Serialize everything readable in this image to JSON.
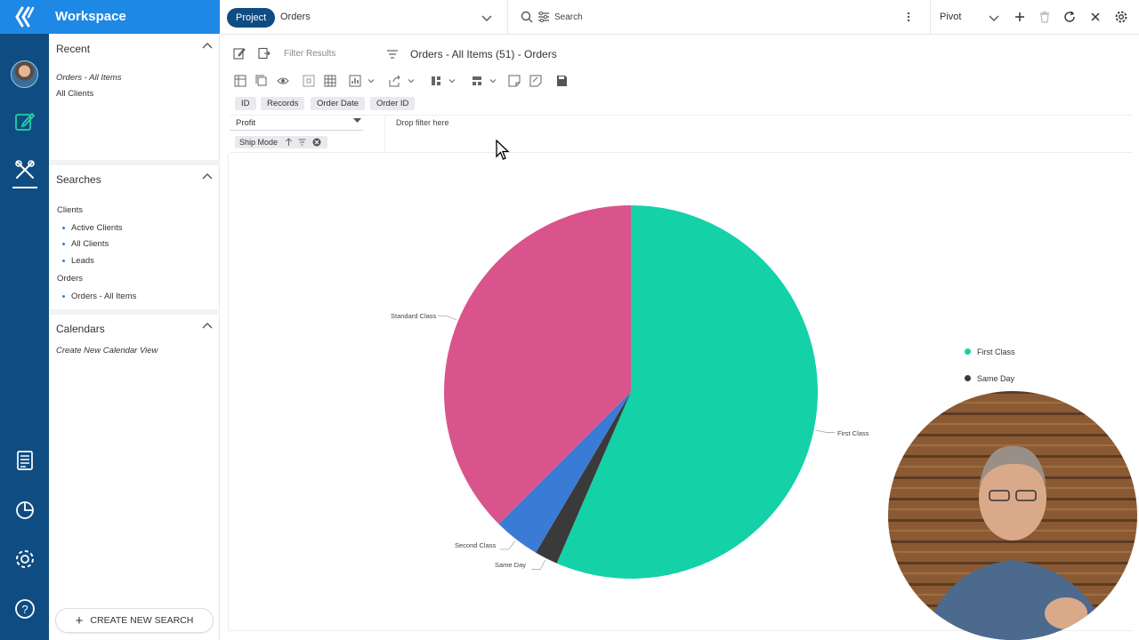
{
  "app": {
    "title": "Workspace"
  },
  "colors": {
    "rail": "#0f4c81",
    "accent": "#1e88e5",
    "first_class": "#14d1a8",
    "standard_class": "#d9538c",
    "second_class": "#3a7bd5",
    "same_day": "#3a3a3a"
  },
  "topbar": {
    "project_label": "Project",
    "breadcrumb": "Orders",
    "search_placeholder": "Search",
    "view_mode": "Pivot"
  },
  "sidebar": {
    "recent": {
      "title": "Recent",
      "items": [
        {
          "label": "Orders - All Items",
          "italic": true
        },
        {
          "label": "All Clients",
          "italic": false
        }
      ]
    },
    "searches": {
      "title": "Searches",
      "groups": [
        {
          "label": "Clients",
          "items": [
            "Active Clients",
            "All Clients",
            "Leads"
          ]
        },
        {
          "label": "Orders",
          "items": [
            "Orders - All Items"
          ]
        }
      ]
    },
    "calendars": {
      "title": "Calendars",
      "create_label": "Create New Calendar View"
    },
    "create_search_label": "CREATE NEW SEARCH"
  },
  "content": {
    "filter_placeholder": "Filter Results",
    "title": "Orders - All Items (51) - Orders",
    "fields": [
      "ID",
      "Records",
      "Order Date",
      "Order ID"
    ],
    "value_field": "Profit",
    "drop_filter": "Drop filter here",
    "row_field": "Ship Mode"
  },
  "chart_data": {
    "type": "pie",
    "slices": [
      {
        "label": "First Class",
        "value": 56.5,
        "color": "#14d1a8"
      },
      {
        "label": "Same Day",
        "value": 2.0,
        "color": "#3a3a3a"
      },
      {
        "label": "Second Class",
        "value": 4.0,
        "color": "#3a7bd5"
      },
      {
        "label": "Standard Class",
        "value": 37.5,
        "color": "#d9538c"
      }
    ],
    "legend": [
      {
        "label": "First Class",
        "color": "#14d1a8"
      },
      {
        "label": "Same Day",
        "color": "#3a3a3a"
      }
    ],
    "legend_position": "right"
  }
}
